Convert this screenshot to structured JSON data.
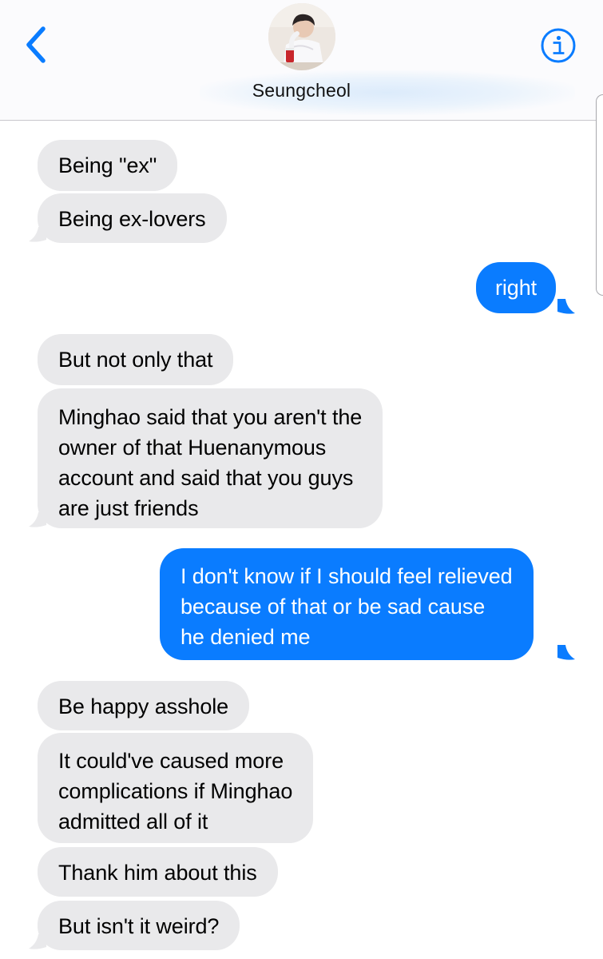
{
  "header": {
    "contact_name": "Seungcheol",
    "back_icon": "chevron-left-icon",
    "info_icon": "info-circle-icon",
    "accent_color": "#0a7cff"
  },
  "colors": {
    "incoming_bubble": "#e9e9eb",
    "outgoing_bubble": "#0a7cff",
    "outgoing_text": "#ffffff",
    "incoming_text": "#000000"
  },
  "messages": [
    {
      "direction": "incoming",
      "lines": [
        "Being \"ex\""
      ]
    },
    {
      "direction": "incoming",
      "lines": [
        "Being ex-lovers"
      ]
    },
    {
      "direction": "outgoing",
      "lines": [
        "right"
      ]
    },
    {
      "direction": "incoming",
      "lines": [
        "But not only that"
      ]
    },
    {
      "direction": "incoming",
      "lines": [
        "Minghao said that you aren't the",
        "owner of that Huenanymous",
        "account and said that you guys",
        "are just friends"
      ]
    },
    {
      "direction": "outgoing",
      "lines": [
        "I don't know if I should feel relieved",
        "because of that or be sad cause",
        "he denied me"
      ]
    },
    {
      "direction": "incoming",
      "lines": [
        "Be happy asshole"
      ]
    },
    {
      "direction": "incoming",
      "lines": [
        "It could've caused more",
        "complications if Minghao",
        "admitted all of it"
      ]
    },
    {
      "direction": "incoming",
      "lines": [
        "Thank him about this"
      ]
    },
    {
      "direction": "incoming",
      "lines": [
        "But isn't it weird?"
      ]
    }
  ]
}
